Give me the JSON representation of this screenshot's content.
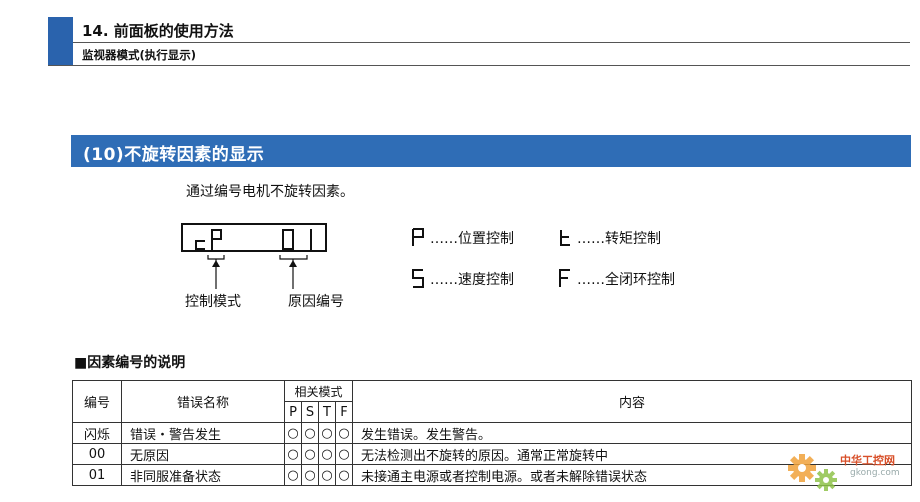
{
  "chapter": {
    "title": "14. 前面板的使用方法",
    "subtitle": "监视器模式(执行显示)",
    "accent_color": "#2a63ad"
  },
  "section": {
    "title": "(10)不旋转因素的显示",
    "band_color": "#2f6db6"
  },
  "intro": "通过编号电机不旋转因素。",
  "display": {
    "digits": [
      "c",
      "P",
      " ",
      " ",
      "0",
      "1"
    ],
    "label_control_mode": "控制模式",
    "label_cause_no": "原因编号"
  },
  "legend": [
    {
      "glyph": "P",
      "text": "……位置控制"
    },
    {
      "glyph": "t",
      "text": "……转矩控制"
    },
    {
      "glyph": "S",
      "text": "……速度控制"
    },
    {
      "glyph": "F",
      "text": "……全闭环控制"
    }
  ],
  "table": {
    "title": "■因素编号的说明",
    "headers": {
      "no": "编号",
      "name": "错误名称",
      "modes_group": "相关模式",
      "modes": [
        "P",
        "S",
        "T",
        "F"
      ],
      "desc": "内容"
    },
    "rows": [
      {
        "no": "闪烁",
        "name": "错误・警告发生",
        "marks": [
          "○",
          "○",
          "○",
          "○"
        ],
        "desc": "发生错误。发生警告。"
      },
      {
        "no": "00",
        "name": "无原因",
        "marks": [
          "○",
          "○",
          "○",
          "○"
        ],
        "desc": "无法检测出不旋转的原因。通常正常旋转中"
      },
      {
        "no": "01",
        "name": "非同服准备状态",
        "marks": [
          "○",
          "○",
          "○",
          "○"
        ],
        "desc": "未接通主电源或者控制电源。或者未解除错误状态"
      }
    ]
  },
  "watermark": {
    "name": "中华工控网",
    "url": "gkong.com",
    "icon": "gear-icon"
  }
}
